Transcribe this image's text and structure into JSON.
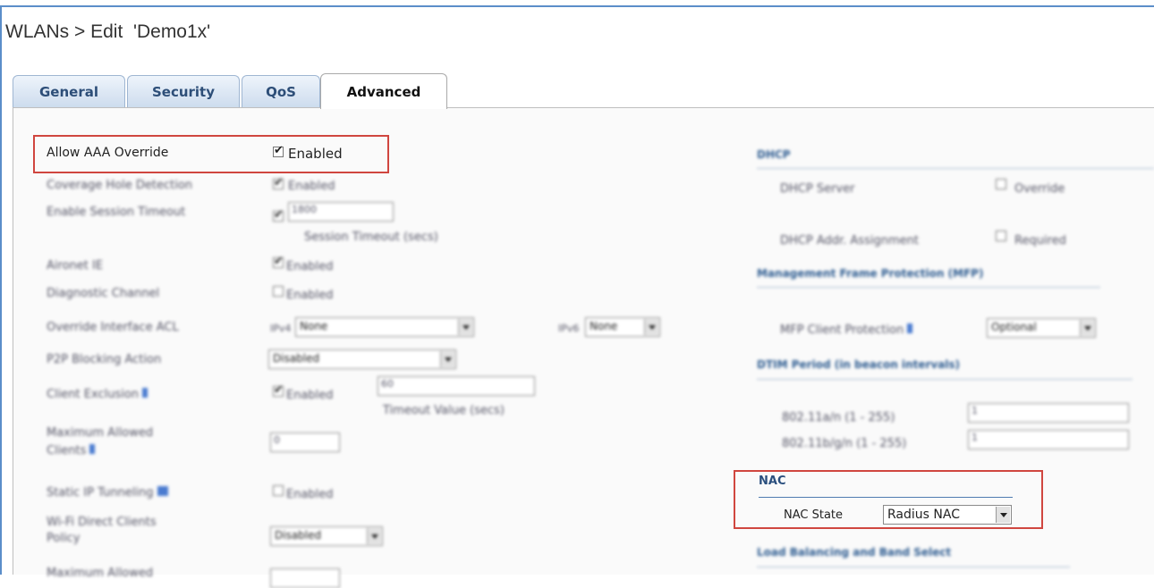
{
  "header": {
    "title": "WLANs > Edit  'Demo1x'"
  },
  "tabs": [
    {
      "label": "General"
    },
    {
      "label": "Security"
    },
    {
      "label": "QoS"
    },
    {
      "label": "Advanced"
    }
  ],
  "left": {
    "allow_aaa_override": {
      "label": "Allow AAA Override",
      "value": "Enabled"
    },
    "coverage_hole": {
      "label": "Coverage Hole Detection",
      "value": "Enabled"
    },
    "session_timeout": {
      "label": "Enable Session Timeout",
      "input": "1800",
      "sub_label": "Session Timeout (secs)"
    },
    "aironet_ie": {
      "label": "Aironet IE",
      "value": "Enabled"
    },
    "diagnostic_channel": {
      "label": "Diagnostic Channel",
      "value": "Enabled"
    },
    "override_acl": {
      "label": "Override Interface ACL",
      "ipv4_label": "IPv4",
      "ipv4_value": "None",
      "ipv6_label": "IPv6",
      "ipv6_value": "None"
    },
    "p2p_blocking": {
      "label": "P2P Blocking Action",
      "value": "Disabled"
    },
    "client_exclusion": {
      "label": "Client Exclusion",
      "value": "Enabled",
      "input": "60",
      "sub_label": "Timeout Value (secs)"
    },
    "max_clients": {
      "label_line1": "Maximum Allowed",
      "label_line2": "Clients",
      "input": "0"
    },
    "static_ip": {
      "label": "Static IP Tunneling",
      "value": "Enabled"
    },
    "wifi_direct": {
      "label_line1": "Wi-Fi Direct Clients",
      "label_line2": "Policy",
      "value": "Disabled"
    },
    "max_allowed_partial": {
      "label": "Maximum Allowed"
    }
  },
  "right": {
    "dhcp": {
      "heading": "DHCP",
      "server_label": "DHCP Server",
      "server_value": "Override",
      "addr_label": "DHCP Addr. Assignment",
      "addr_value": "Required"
    },
    "mfp": {
      "heading": "Management Frame Protection (MFP)",
      "client_label": "MFP Client Protection",
      "client_value": "Optional"
    },
    "dtim": {
      "heading": "DTIM Period (in beacon intervals)",
      "a_label": "802.11a/n (1 - 255)",
      "a_value": "1",
      "b_label": "802.11b/g/n (1 - 255)",
      "b_value": "1"
    },
    "nac": {
      "heading": "NAC",
      "state_label": "NAC State",
      "state_value": "Radius NAC"
    },
    "load_balancing": {
      "heading": "Load Balancing and Band Select"
    }
  }
}
